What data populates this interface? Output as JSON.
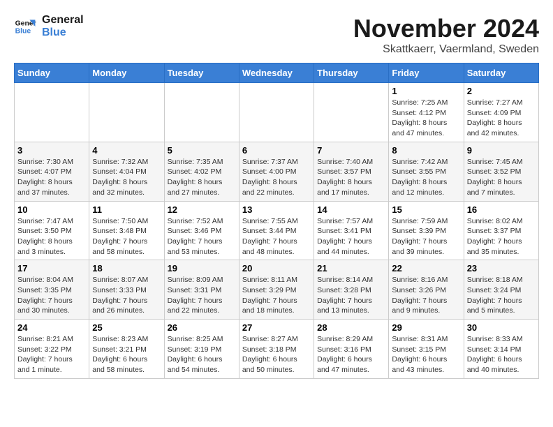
{
  "header": {
    "logo_line1": "General",
    "logo_line2": "Blue",
    "month_title": "November 2024",
    "subtitle": "Skattkaerr, Vaermland, Sweden"
  },
  "days_of_week": [
    "Sunday",
    "Monday",
    "Tuesday",
    "Wednesday",
    "Thursday",
    "Friday",
    "Saturday"
  ],
  "weeks": [
    [
      {
        "day": "",
        "info": ""
      },
      {
        "day": "",
        "info": ""
      },
      {
        "day": "",
        "info": ""
      },
      {
        "day": "",
        "info": ""
      },
      {
        "day": "",
        "info": ""
      },
      {
        "day": "1",
        "info": "Sunrise: 7:25 AM\nSunset: 4:12 PM\nDaylight: 8 hours and 47 minutes."
      },
      {
        "day": "2",
        "info": "Sunrise: 7:27 AM\nSunset: 4:09 PM\nDaylight: 8 hours and 42 minutes."
      }
    ],
    [
      {
        "day": "3",
        "info": "Sunrise: 7:30 AM\nSunset: 4:07 PM\nDaylight: 8 hours and 37 minutes."
      },
      {
        "day": "4",
        "info": "Sunrise: 7:32 AM\nSunset: 4:04 PM\nDaylight: 8 hours and 32 minutes."
      },
      {
        "day": "5",
        "info": "Sunrise: 7:35 AM\nSunset: 4:02 PM\nDaylight: 8 hours and 27 minutes."
      },
      {
        "day": "6",
        "info": "Sunrise: 7:37 AM\nSunset: 4:00 PM\nDaylight: 8 hours and 22 minutes."
      },
      {
        "day": "7",
        "info": "Sunrise: 7:40 AM\nSunset: 3:57 PM\nDaylight: 8 hours and 17 minutes."
      },
      {
        "day": "8",
        "info": "Sunrise: 7:42 AM\nSunset: 3:55 PM\nDaylight: 8 hours and 12 minutes."
      },
      {
        "day": "9",
        "info": "Sunrise: 7:45 AM\nSunset: 3:52 PM\nDaylight: 8 hours and 7 minutes."
      }
    ],
    [
      {
        "day": "10",
        "info": "Sunrise: 7:47 AM\nSunset: 3:50 PM\nDaylight: 8 hours and 3 minutes."
      },
      {
        "day": "11",
        "info": "Sunrise: 7:50 AM\nSunset: 3:48 PM\nDaylight: 7 hours and 58 minutes."
      },
      {
        "day": "12",
        "info": "Sunrise: 7:52 AM\nSunset: 3:46 PM\nDaylight: 7 hours and 53 minutes."
      },
      {
        "day": "13",
        "info": "Sunrise: 7:55 AM\nSunset: 3:44 PM\nDaylight: 7 hours and 48 minutes."
      },
      {
        "day": "14",
        "info": "Sunrise: 7:57 AM\nSunset: 3:41 PM\nDaylight: 7 hours and 44 minutes."
      },
      {
        "day": "15",
        "info": "Sunrise: 7:59 AM\nSunset: 3:39 PM\nDaylight: 7 hours and 39 minutes."
      },
      {
        "day": "16",
        "info": "Sunrise: 8:02 AM\nSunset: 3:37 PM\nDaylight: 7 hours and 35 minutes."
      }
    ],
    [
      {
        "day": "17",
        "info": "Sunrise: 8:04 AM\nSunset: 3:35 PM\nDaylight: 7 hours and 30 minutes."
      },
      {
        "day": "18",
        "info": "Sunrise: 8:07 AM\nSunset: 3:33 PM\nDaylight: 7 hours and 26 minutes."
      },
      {
        "day": "19",
        "info": "Sunrise: 8:09 AM\nSunset: 3:31 PM\nDaylight: 7 hours and 22 minutes."
      },
      {
        "day": "20",
        "info": "Sunrise: 8:11 AM\nSunset: 3:29 PM\nDaylight: 7 hours and 18 minutes."
      },
      {
        "day": "21",
        "info": "Sunrise: 8:14 AM\nSunset: 3:28 PM\nDaylight: 7 hours and 13 minutes."
      },
      {
        "day": "22",
        "info": "Sunrise: 8:16 AM\nSunset: 3:26 PM\nDaylight: 7 hours and 9 minutes."
      },
      {
        "day": "23",
        "info": "Sunrise: 8:18 AM\nSunset: 3:24 PM\nDaylight: 7 hours and 5 minutes."
      }
    ],
    [
      {
        "day": "24",
        "info": "Sunrise: 8:21 AM\nSunset: 3:22 PM\nDaylight: 7 hours and 1 minute."
      },
      {
        "day": "25",
        "info": "Sunrise: 8:23 AM\nSunset: 3:21 PM\nDaylight: 6 hours and 58 minutes."
      },
      {
        "day": "26",
        "info": "Sunrise: 8:25 AM\nSunset: 3:19 PM\nDaylight: 6 hours and 54 minutes."
      },
      {
        "day": "27",
        "info": "Sunrise: 8:27 AM\nSunset: 3:18 PM\nDaylight: 6 hours and 50 minutes."
      },
      {
        "day": "28",
        "info": "Sunrise: 8:29 AM\nSunset: 3:16 PM\nDaylight: 6 hours and 47 minutes."
      },
      {
        "day": "29",
        "info": "Sunrise: 8:31 AM\nSunset: 3:15 PM\nDaylight: 6 hours and 43 minutes."
      },
      {
        "day": "30",
        "info": "Sunrise: 8:33 AM\nSunset: 3:14 PM\nDaylight: 6 hours and 40 minutes."
      }
    ]
  ]
}
